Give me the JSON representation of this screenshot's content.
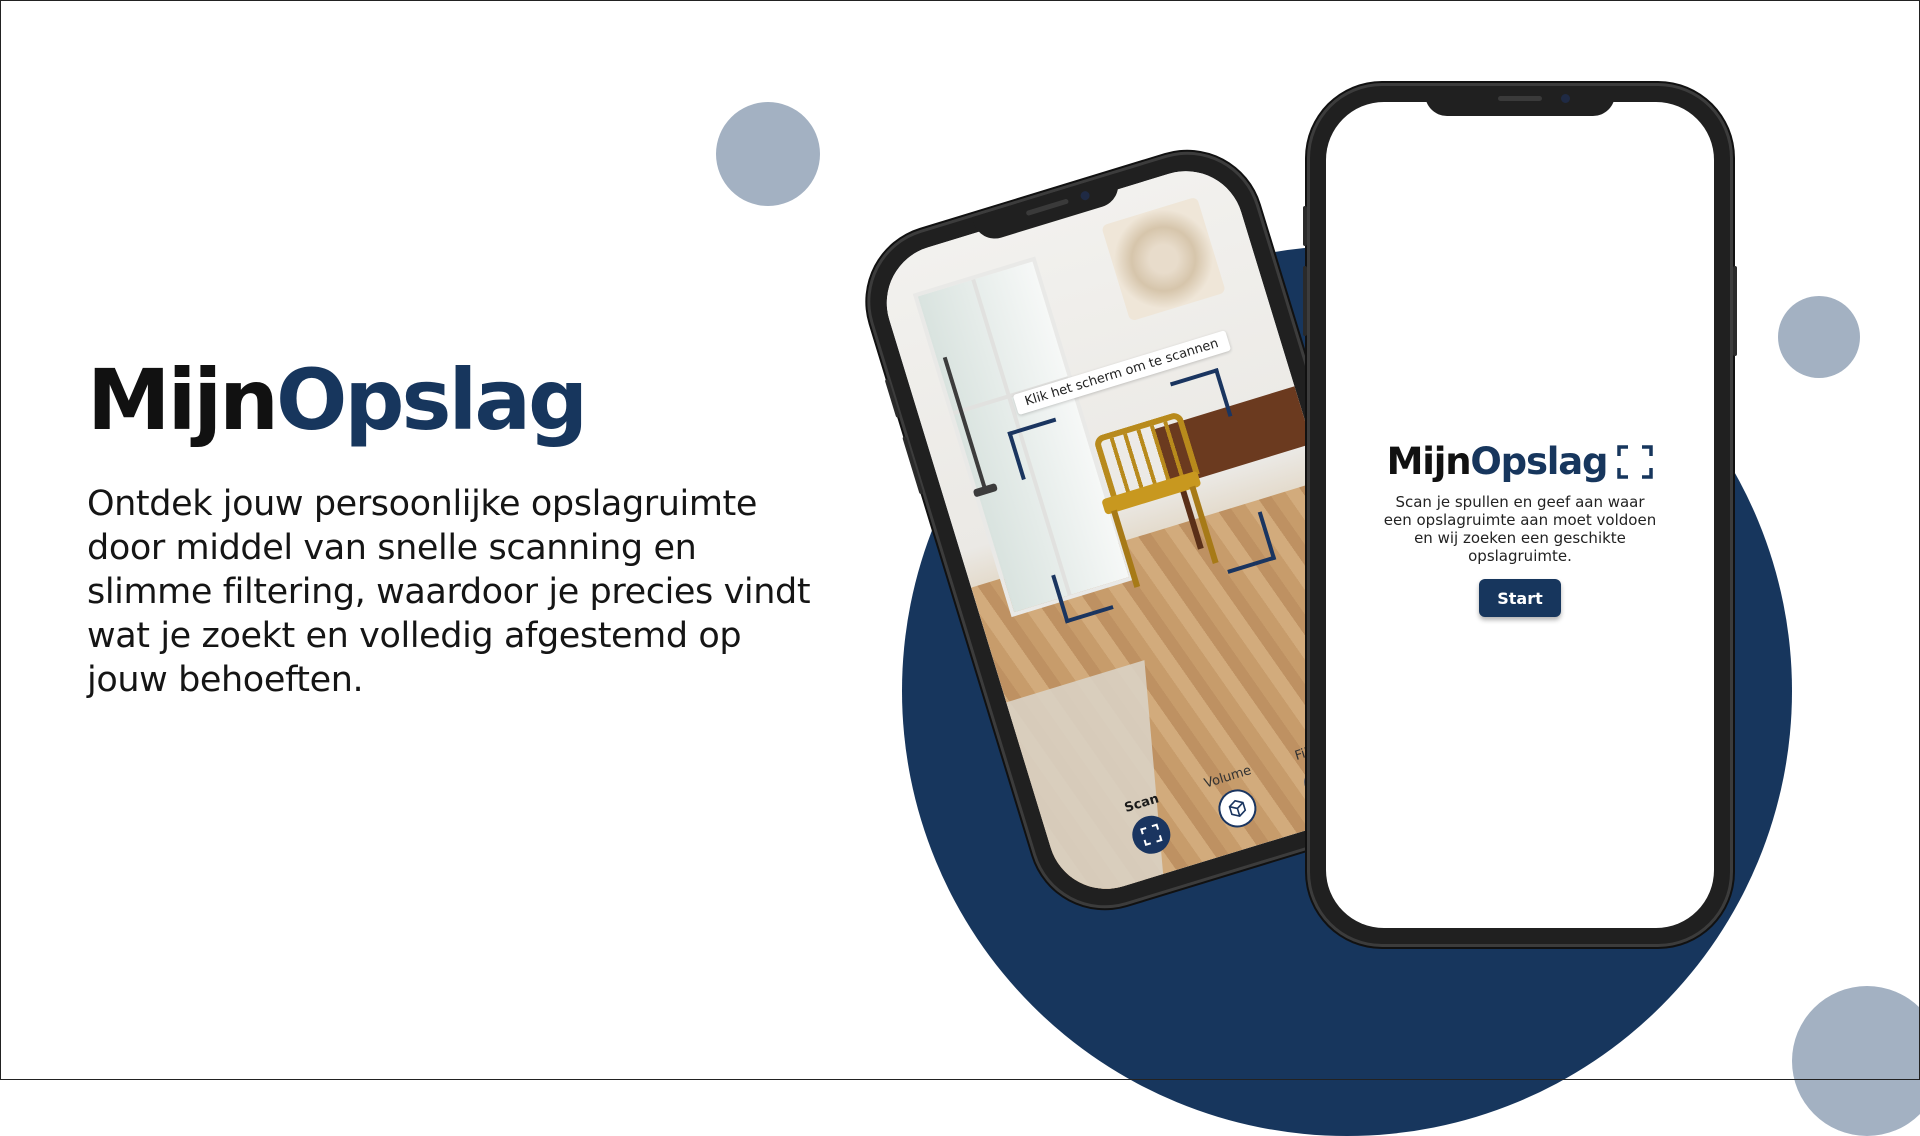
{
  "brand": {
    "part1": "Mijn",
    "part2": "Opslag"
  },
  "tagline": "Ontdek jouw persoonlijke opslagruimte door middel van snelle scanning en slimme filtering, waardoor je precies vindt wat je zoekt en volledig afgestemd op jouw behoeften.",
  "scan_screen": {
    "hint": "Klik het scherm om te scannen",
    "nav": [
      {
        "label": "Scan",
        "icon": "scan-frame-icon",
        "active": true
      },
      {
        "label": "Volume",
        "icon": "cube-icon",
        "active": false
      },
      {
        "label": "Filters",
        "icon": "filter-arrow-icon",
        "active": false
      }
    ]
  },
  "welcome_screen": {
    "logo_part1": "Mijn",
    "logo_part2": "Opslag",
    "logo_icon": "scan-frame-icon",
    "description": "Scan je spullen en geef aan waar een opslagruimte aan moet voldoen en wij zoeken een geschikte opslagruimte.",
    "start_label": "Start"
  },
  "colors": {
    "brand_navy": "#17365d",
    "dark_text": "#111111",
    "decor_gray": "#a3b1c2",
    "phone_body": "#202020"
  }
}
